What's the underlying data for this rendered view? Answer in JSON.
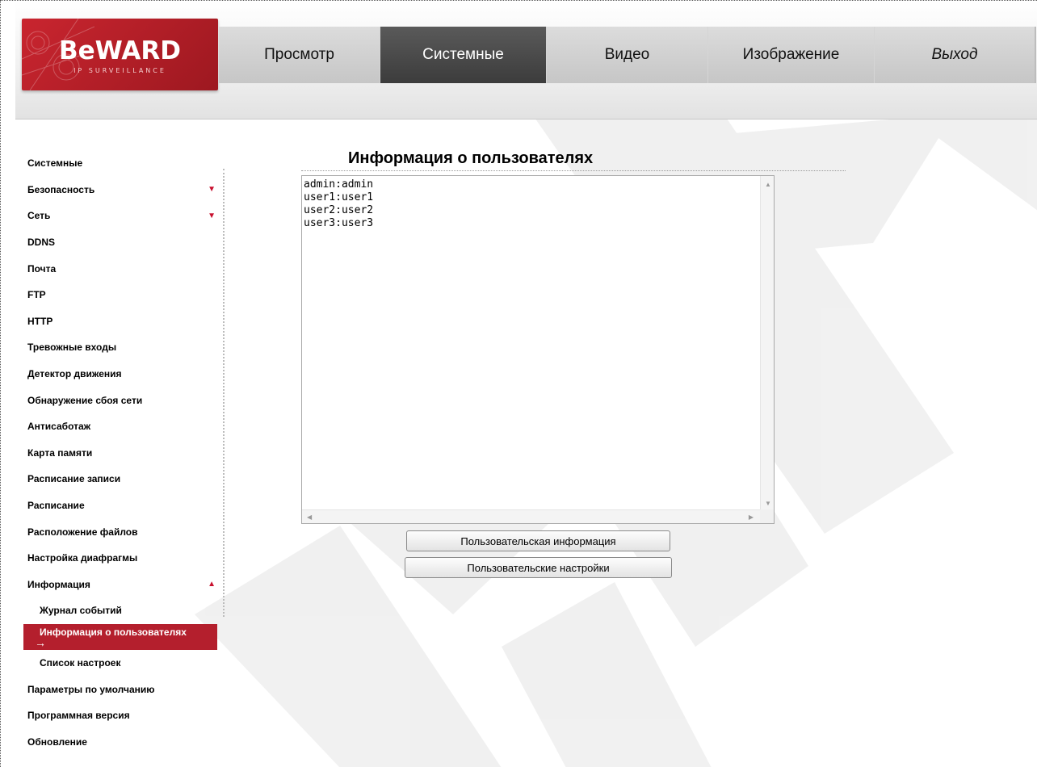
{
  "header": {
    "logo_text": "BeWARD",
    "logo_sub": "IP SURVEILLANCE",
    "tabs": [
      {
        "label": "Просмотр"
      },
      {
        "label": "Системные"
      },
      {
        "label": "Видео"
      },
      {
        "label": "Изображение"
      },
      {
        "label": "Выход"
      }
    ],
    "active_tab": "Системные"
  },
  "sidebar": {
    "items": [
      {
        "label": "Системные"
      },
      {
        "label": "Безопасность",
        "icon": "triangle-down-icon"
      },
      {
        "label": "Сеть",
        "icon": "triangle-down-icon"
      },
      {
        "label": "DDNS"
      },
      {
        "label": "Почта"
      },
      {
        "label": "FTP"
      },
      {
        "label": "HTTP"
      },
      {
        "label": "Тревожные входы"
      },
      {
        "label": "Детектор движения"
      },
      {
        "label": "Обнаружение сбоя сети"
      },
      {
        "label": "Антисаботаж"
      },
      {
        "label": "Карта памяти"
      },
      {
        "label": "Расписание записи"
      },
      {
        "label": "Расписание"
      },
      {
        "label": "Расположение файлов"
      },
      {
        "label": "Настройка диафрагмы"
      },
      {
        "label": "Информация",
        "icon": "triangle-up-icon"
      },
      {
        "label": "Журнал событий"
      },
      {
        "label": "Информация о пользователях",
        "icon": "right-arrow-icon"
      },
      {
        "label": "Список настроек"
      },
      {
        "label": "Параметры по умолчанию"
      },
      {
        "label": "Программная версия"
      },
      {
        "label": "Обновление"
      }
    ],
    "active_item": "Информация о пользователях"
  },
  "main": {
    "title": "Информация о пользователях",
    "users": [
      "admin:admin",
      "user1:user1",
      "user2:user2",
      "user3:user3"
    ],
    "buttons": {
      "user_info": "Пользовательская информация",
      "user_settings": "Пользовательские настройки"
    }
  },
  "colors": {
    "brand_red": "#b41f2d",
    "active_tab_bg": "#4a4a4a",
    "nav_bg": "#d0d0d0"
  }
}
